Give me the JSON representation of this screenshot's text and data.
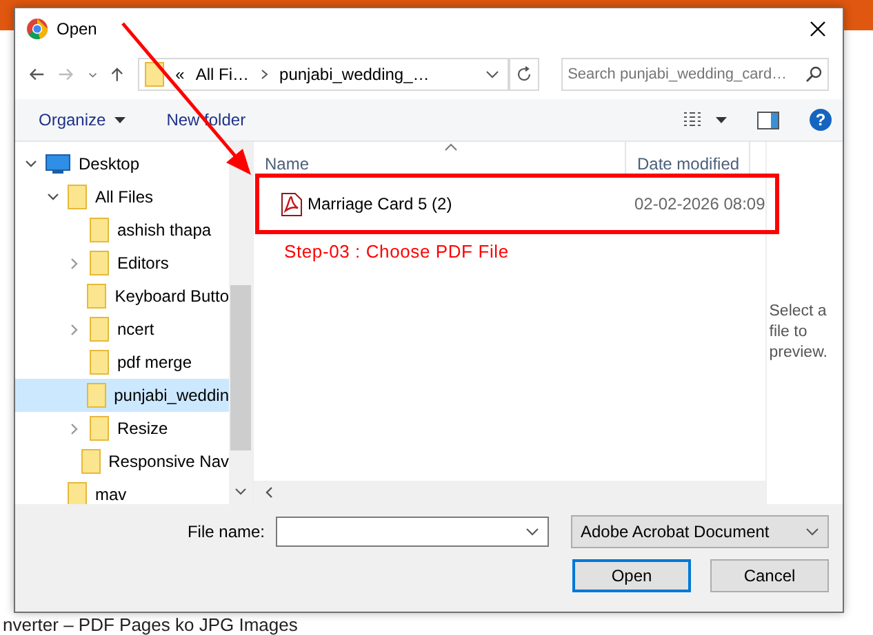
{
  "page": {
    "heading": "nverter – PDF Pages ko JPG Images"
  },
  "window": {
    "title": "Open"
  },
  "address_bar": {
    "prefix": "«",
    "path": [
      "All Fi…",
      "punjabi_wedding_…"
    ]
  },
  "search": {
    "placeholder": "Search punjabi_wedding_card…"
  },
  "toolbar": {
    "buttons": [
      "Organize",
      "New folder"
    ],
    "help": "?"
  },
  "nav_tree": [
    {
      "label": "Desktop",
      "kind": "desktop",
      "expanded": true,
      "selected": false,
      "children": [
        {
          "label": "All Files",
          "kind": "folder",
          "expanded": true,
          "selected": false,
          "children": [
            {
              "label": "ashish thapa",
              "kind": "folder",
              "has_children": false,
              "expanded": false,
              "selected": false
            },
            {
              "label": "Editors",
              "kind": "folder",
              "has_children": true,
              "expanded": false,
              "selected": false
            },
            {
              "label": "Keyboard Butto",
              "kind": "folder",
              "has_children": false,
              "expanded": false,
              "selected": false
            },
            {
              "label": "ncert",
              "kind": "folder",
              "has_children": true,
              "expanded": false,
              "selected": false
            },
            {
              "label": "pdf merge",
              "kind": "folder",
              "has_children": false,
              "expanded": false,
              "selected": false
            },
            {
              "label": "punjabi_weddin",
              "kind": "folder",
              "has_children": false,
              "expanded": false,
              "selected": true
            },
            {
              "label": "Resize",
              "kind": "folder",
              "has_children": true,
              "expanded": false,
              "selected": false
            },
            {
              "label": "Responsive Nav",
              "kind": "folder",
              "has_children": false,
              "expanded": false,
              "selected": false
            }
          ]
        },
        {
          "label": "mav",
          "kind": "folder",
          "has_children": false,
          "expanded": false,
          "selected": false
        }
      ]
    }
  ],
  "file_list": {
    "columns": [
      "Name",
      "Date modified"
    ],
    "rows": [
      {
        "name": "Marriage Card 5 (2)",
        "date_modified": "02-02-2026 08:09",
        "selected": false
      }
    ]
  },
  "preview": {
    "message": "Select a file to preview."
  },
  "annotation": {
    "step_label": "Step-03 : Choose PDF File"
  },
  "file_name": {
    "label": "File name:"
  },
  "file_type": {
    "value": "Adobe Acrobat Document"
  },
  "buttons": [
    {
      "label": "Open",
      "default": true
    },
    {
      "label": "Cancel",
      "default": false
    }
  ]
}
